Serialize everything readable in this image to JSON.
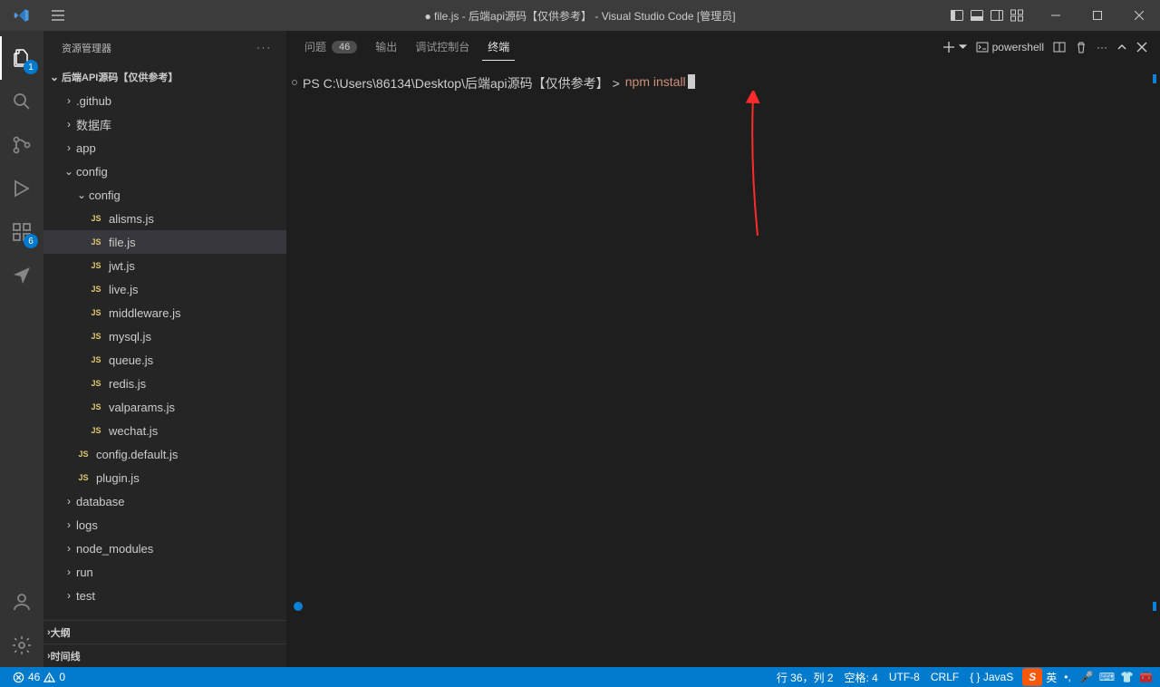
{
  "titlebar": {
    "title": "● file.js - 后端api源码【仅供参考】 - Visual Studio Code [管理员]"
  },
  "activitybar": {
    "explorer_badge": "1",
    "extensions_badge": "6"
  },
  "sidebar": {
    "header": "资源管理器",
    "root": "后端API源码【仅供参考】",
    "folders": {
      "github": ".github",
      "database_top": "数据库",
      "app": "app",
      "config": "config",
      "config_inner": "config",
      "database": "database",
      "logs": "logs",
      "node_modules": "node_modules",
      "run": "run",
      "test": "test"
    },
    "files": {
      "alisms": "alisms.js",
      "file": "file.js",
      "jwt": "jwt.js",
      "live": "live.js",
      "middleware": "middleware.js",
      "mysql": "mysql.js",
      "queue": "queue.js",
      "redis": "redis.js",
      "valparams": "valparams.js",
      "wechat": "wechat.js",
      "config_default": "config.default.js",
      "plugin": "plugin.js"
    },
    "sections": {
      "outline": "大纲",
      "timeline": "时间线"
    }
  },
  "panel": {
    "problems": "问题",
    "problems_count": "46",
    "output": "输出",
    "debug_console": "调试控制台",
    "terminal": "终端",
    "shell": "powershell"
  },
  "terminal": {
    "prompt_prefix": "PS",
    "path": "C:\\Users\\86134\\Desktop\\后端api源码【仅供参考】",
    "gt": ">",
    "command": "npm install"
  },
  "statusbar": {
    "errors": "46",
    "warnings": "0",
    "ln_col": "行 36，列 2",
    "spaces": "空格: 4",
    "encoding": "UTF-8",
    "eol": "CRLF",
    "lang": "{ }  JavaS",
    "ime_lang": "英",
    "ime_punct": "•,"
  },
  "icons": {
    "js": "JS"
  }
}
